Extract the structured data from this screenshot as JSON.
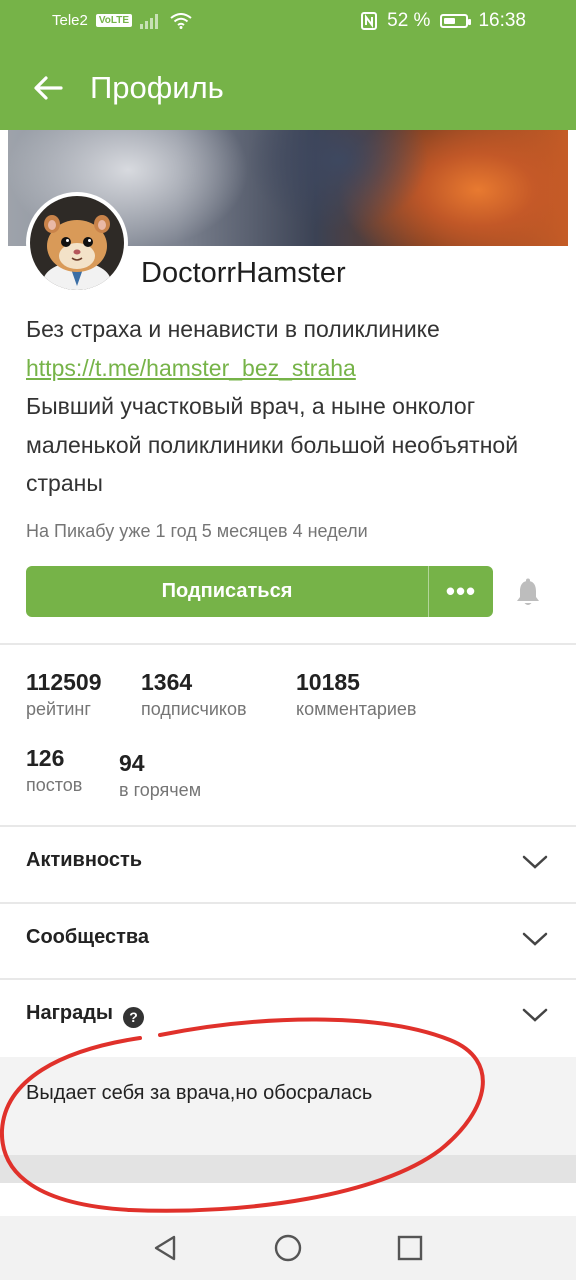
{
  "status_bar": {
    "carrier": "Tele2",
    "volte": "VoLTE",
    "battery": "52 %",
    "battery_level": 0.52,
    "time": "16:38"
  },
  "app_bar": {
    "title": "Профиль",
    "back_icon": "arrow-left-icon"
  },
  "profile": {
    "username": "DoctorrHamster",
    "bio_line1": "Без страха и ненависти в поликлинике",
    "bio_link": "https://t.me/hamster_bez_straha",
    "bio_line2": "Бывший участковый врач, а ныне онколог маленькой поликлиники большой необъятной страны",
    "since": "На Пикабу уже 1 год 5 месяцев 4 недели",
    "subscribe_label": "Подписаться",
    "more_label": "•••"
  },
  "stats": [
    {
      "value": "112509",
      "label": "рейтинг"
    },
    {
      "value": "1364",
      "label": "подписчиков"
    },
    {
      "value": "10185",
      "label": "комментариев"
    },
    {
      "value": "126",
      "label": "постов"
    },
    {
      "value": "94",
      "label": "в горячем"
    }
  ],
  "sections": [
    {
      "title": "Активность"
    },
    {
      "title": "Сообщества"
    },
    {
      "title": "Награды"
    }
  ],
  "award_text": "Выдает себя за врача,но обосралась",
  "colors": {
    "accent": "#76b348",
    "annotation": "#e0312b"
  }
}
